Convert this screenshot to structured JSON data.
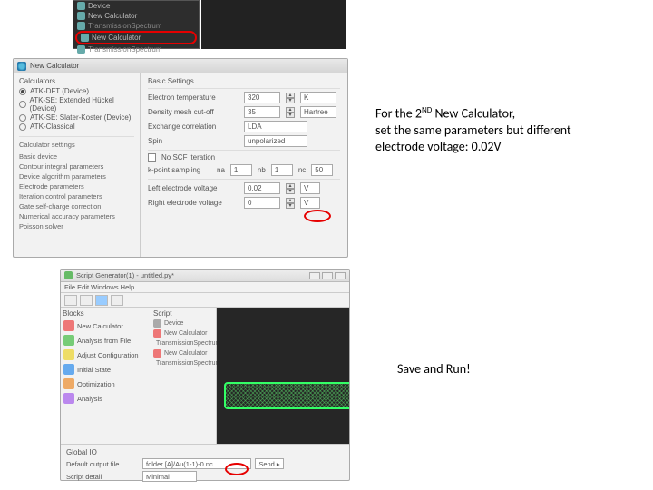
{
  "tree": {
    "items": [
      {
        "label": "Device"
      },
      {
        "label": "New Calculator"
      },
      {
        "label": "TransmissionSpectrum"
      },
      {
        "label": "New Calculator"
      },
      {
        "label": "TransmissionSpectrum"
      }
    ]
  },
  "calc": {
    "title": "New Calculator",
    "calculators_label": "Calculators",
    "radios": [
      {
        "label": "ATK-DFT (Device)",
        "checked": true
      },
      {
        "label": "ATK-SE: Extended Hückel (Device)",
        "checked": false
      },
      {
        "label": "ATK-SE: Slater-Koster (Device)",
        "checked": false
      },
      {
        "label": "ATK-Classical",
        "checked": false
      }
    ],
    "settings_label": "Calculator settings",
    "settings": [
      "Basic device",
      "Contour integral parameters",
      "Device algorithm parameters",
      "Electrode parameters",
      "Iteration control parameters",
      "Gate self-charge correction",
      "Numerical accuracy parameters",
      "Poisson solver"
    ],
    "basic_heading": "Basic Settings",
    "fields": {
      "ecut_label": "Electron temperature",
      "ecut_val": "320",
      "ecut_unit": "K",
      "mesh_label": "Density mesh cut-off",
      "mesh_val": "35",
      "mesh_unit": "Hartree",
      "xc_label": "Exchange correlation",
      "xc_val": "LDA",
      "spin_label": "Spin",
      "spin_val": "unpolarized",
      "scf_chk": "No SCF iteration",
      "kpoint_label": "k-point sampling",
      "na": "na",
      "na_val": "1",
      "nb": "nb",
      "nb_val": "1",
      "nc": "nc",
      "nc_val": "50",
      "lev_label": "Left electrode voltage",
      "lev_val": "0.02",
      "lev_unit": "V",
      "rev_label": "Right electrode voltage",
      "rev_val": "0",
      "rev_unit": "V"
    }
  },
  "sg": {
    "title": "Script Generator(1) - untitled.py*",
    "menu": "File   Edit   Windows   Help",
    "blocks_h": "Blocks",
    "script_h": "Script",
    "blocks": [
      {
        "label": "New Calculator",
        "c": "c-red"
      },
      {
        "label": "Analysis from File",
        "c": "c-grn"
      },
      {
        "label": "Adjust Configuration",
        "c": "c-yel"
      },
      {
        "label": "Initial State",
        "c": "c-blu"
      },
      {
        "label": "Optimization",
        "c": "c-org"
      },
      {
        "label": "Analysis",
        "c": "c-pur"
      }
    ],
    "script_items": [
      {
        "label": "Device",
        "c": "c-gray"
      },
      {
        "label": "New Calculator",
        "c": "c-red"
      },
      {
        "label": "TransmissionSpectrum",
        "c": "c-pur"
      },
      {
        "label": "New Calculator",
        "c": "c-red"
      },
      {
        "label": "TransmissionSpectrum",
        "c": "c-pur"
      }
    ],
    "global_io": "Global IO",
    "out_label": "Default output file",
    "out_val": "folder [A]/Au(1-1)-0.nc",
    "send_btn": "Send ▸",
    "detail_label": "Script detail",
    "detail_val": "Minimal"
  },
  "anno": {
    "l1_a": "For the 2",
    "l1_sup": "ND",
    "l1_b": " New Calculator,",
    "l2": "set the same parameters but different",
    "l3": "electrode voltage: 0.02V",
    "run": "Save and Run!"
  }
}
